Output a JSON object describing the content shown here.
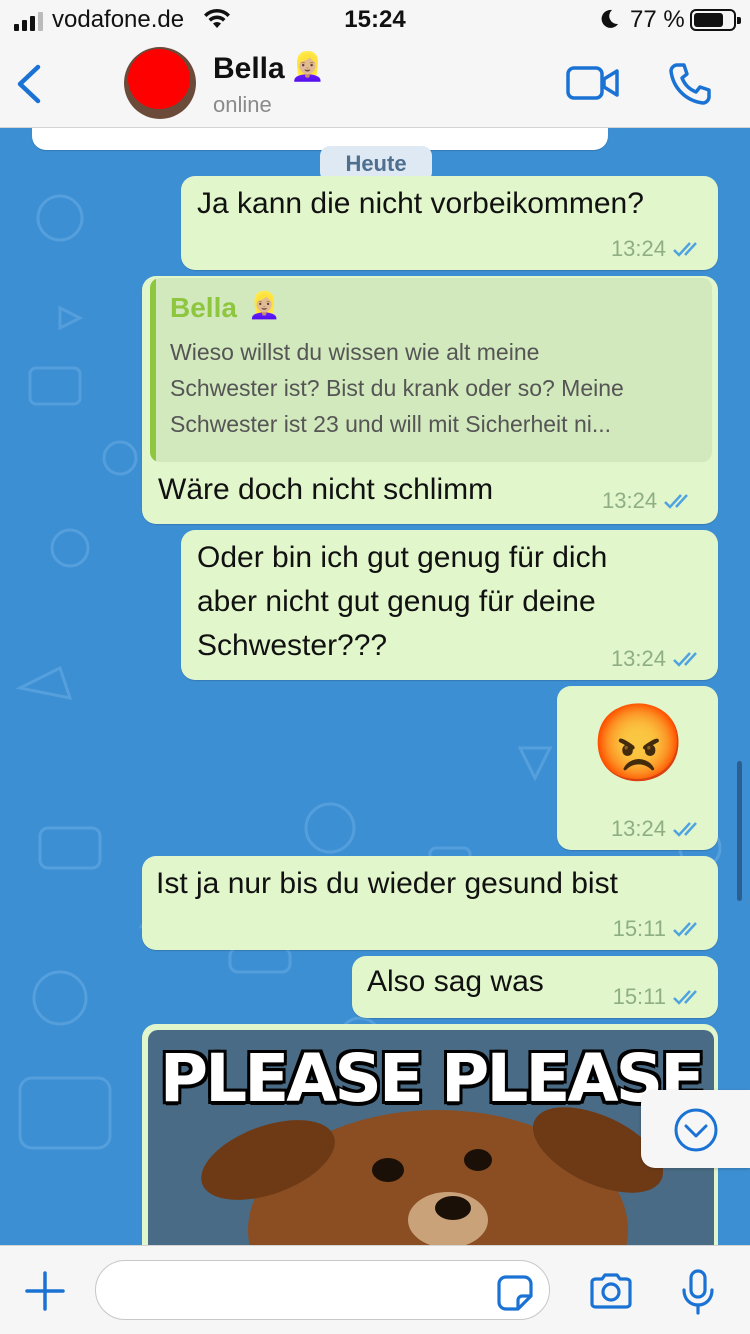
{
  "status_bar": {
    "carrier": "vodafone.de",
    "time": "15:24",
    "battery_percent": "77 %",
    "battery_level": 0.77
  },
  "header": {
    "back_icon": "chevron-left-icon",
    "contact_name": "Bella",
    "contact_emoji": "👱🏼‍♀️",
    "status": "online"
  },
  "chat": {
    "date_divider": "Heute",
    "messages": [
      {
        "text": "Ja kann die nicht vorbeikommen?",
        "time": "13:24"
      },
      {
        "quote": {
          "author": "Bella",
          "author_emoji": "👱🏼‍♀️",
          "text": "Wieso willst du wissen wie alt meine\nSchwester ist? Bist du krank oder so? Meine\nSchwester ist 23 und will mit Sicherheit ni..."
        },
        "text": "Wäre doch nicht schlimm",
        "time": "13:24"
      },
      {
        "lines": [
          "Oder bin ich gut genug für dich",
          "aber nicht gut genug für deine",
          "Schwester???"
        ],
        "time": "13:24"
      },
      {
        "emoji": "😡",
        "time": "13:24"
      },
      {
        "text": "Ist ja nur bis du wieder gesund bist",
        "time": "15:11"
      },
      {
        "text": "Also sag was",
        "time": "15:11"
      },
      {
        "image_text": "PLEASE PLEASE"
      }
    ]
  },
  "colors": {
    "chat_background": "#3d8fd3",
    "outgoing_bubble": "#e1f6cb",
    "accent": "#1a73d4",
    "quote_author": "#8ec63f"
  },
  "input": {
    "placeholder": "",
    "value": ""
  }
}
